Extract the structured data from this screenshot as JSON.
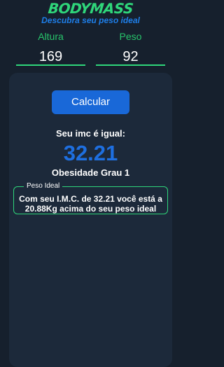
{
  "header": {
    "title": "BODYMASS",
    "subtitle": "Descubra seu peso ideal"
  },
  "inputs": {
    "altura": {
      "label": "Altura",
      "value": "169"
    },
    "peso": {
      "label": "Peso",
      "value": "92"
    }
  },
  "actions": {
    "calculate_label": "Calcular"
  },
  "result": {
    "label": "Seu imc é igual:",
    "value": "32.21",
    "category": "Obesidade Grau 1"
  },
  "ideal": {
    "legend": "Peso Ideal",
    "line1": "Com seu I.M.C. de 32.21 você está a",
    "line2": "20.88Kg acima do seu peso ideal"
  },
  "colors": {
    "background": "#16202d",
    "panel": "#1c293a",
    "brand_green": "#2fd67a",
    "brand_blue": "#1e7ee8",
    "button": "#1968d8",
    "result_blue": "#1e6fe0"
  }
}
